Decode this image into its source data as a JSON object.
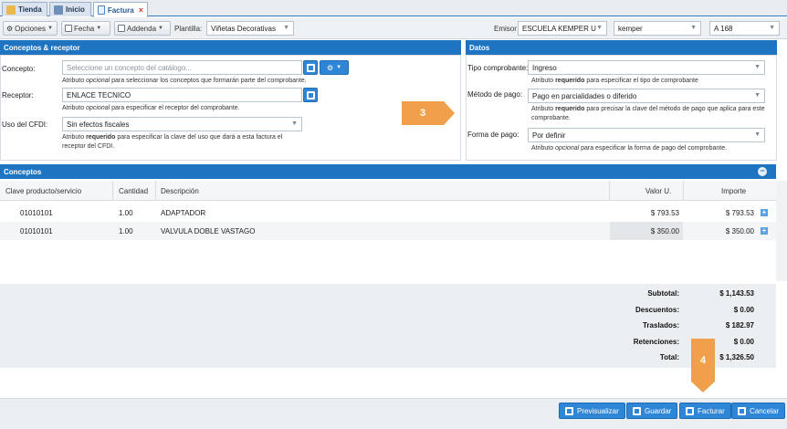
{
  "tabs": [
    {
      "label": "Tienda"
    },
    {
      "label": "Inicio"
    },
    {
      "label": "Factura",
      "close": "×"
    }
  ],
  "toolbar": {
    "opciones": "Opciones",
    "fecha": "Fecha",
    "addenda": "Addenda",
    "plantilla_label": "Plantilla:",
    "plantilla_value": "Viñetas Decorativas",
    "emisor_label": "Emisor",
    "emisor_value": "ESCUELA KEMPER U",
    "user_value": "kemper",
    "serie_value": "A 168"
  },
  "conceptos_receptor": {
    "title": "Conceptos & receptor",
    "concepto_label": "Concepto:",
    "concepto_placeholder": "Seleccione un concepto del catálogo...",
    "concepto_hint_pre": "Atributo ",
    "concepto_hint_em": "opcional",
    "concepto_hint_post": " para seleccionar los conceptos que formarán parte del comprobante.",
    "receptor_label": "Receptor:",
    "receptor_value": "ENLACE TECNICO",
    "receptor_hint_pre": "Atributo ",
    "receptor_hint_em": "opcional",
    "receptor_hint_post": " para especificar el receptor del comprobante.",
    "uso_label": "Uso del CFDI:",
    "uso_value": "Sin efectos fiscales",
    "uso_hint_pre": "Atributo ",
    "uso_hint_strong": "requerido",
    "uso_hint_post": " para especificar la clave del uso que dará a esta factura el receptor del CFDI."
  },
  "datos": {
    "title": "Datos",
    "tipo_label": "Tipo comprobante:",
    "tipo_value": "Ingreso",
    "tipo_hint_pre": "Atributo ",
    "tipo_hint_strong": "requerido",
    "tipo_hint_post": " para especificar el tipo de comprobante",
    "metodo_label": "Método de pago:",
    "metodo_value": "Pago en parcialidades o diferido",
    "metodo_hint_pre": "Atributo ",
    "metodo_hint_strong": "requerido",
    "metodo_hint_post": " para precisar la clave del método de pago que aplica para este comprobante.",
    "forma_label": "Forma de pago:",
    "forma_value": "Por definir",
    "forma_hint_pre": "Atributo ",
    "forma_hint_em": "opcional",
    "forma_hint_post": " para especificar la forma de pago del comprobante."
  },
  "callouts": {
    "three": "3",
    "four": "4"
  },
  "conceptos": {
    "title": "Conceptos",
    "columns": [
      "Clave producto/servicio",
      "Cantidad",
      "Descripción",
      "Valor U.",
      "Importe"
    ],
    "rows": [
      {
        "clave": "01010101",
        "cantidad": "1.00",
        "descripcion": "ADAPTADOR",
        "valor": "$ 793.53",
        "importe": "$ 793.53"
      },
      {
        "clave": "01010101",
        "cantidad": "1.00",
        "descripcion": "VALVULA DOBLE VASTAGO",
        "valor": "$ 350.00",
        "importe": "$ 350.00"
      }
    ]
  },
  "totals": [
    {
      "label": "Subtotal:",
      "value": "$ 1,143.53"
    },
    {
      "label": "Descuentos:",
      "value": "$ 0.00"
    },
    {
      "label": "Traslados:",
      "value": "$ 182.97"
    },
    {
      "label": "Retenciones:",
      "value": "$ 0.00"
    },
    {
      "label": "Total:",
      "value": "$ 1,326.50"
    }
  ],
  "footer": {
    "previsualizar": "Previsualizar",
    "guardar": "Guardar",
    "facturar": "Facturar",
    "cancelar": "Cancelar"
  },
  "colors": {
    "primary": "#1f74c2",
    "button": "#2f86d6",
    "callout": "#f0a04b"
  }
}
